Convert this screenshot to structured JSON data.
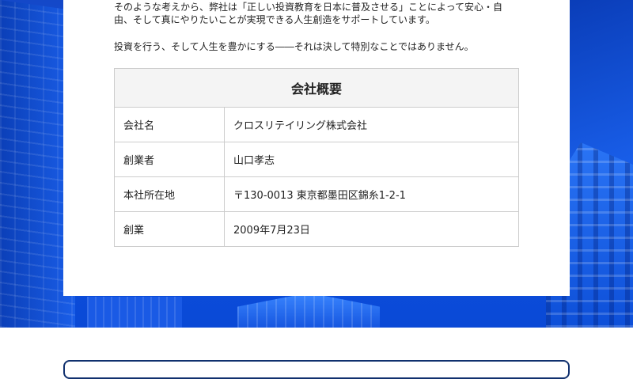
{
  "intro": {
    "line1": "そのような考えから、弊社は「正しい投資教育を日本に普及させる」ことによって安心・自",
    "line2": "由、そして真にやりたいことが実現できる人生創造をサポートしています。",
    "line3": "投資を行う、そして人生を豊かにする――それは決して特別なことではありません。"
  },
  "company_table": {
    "title": "会社概要",
    "rows": [
      {
        "label": "会社名",
        "value": "クロスリテイリング株式会社"
      },
      {
        "label": "創業者",
        "value": "山口孝志"
      },
      {
        "label": "本社所在地",
        "value": "〒130-0013 東京都墨田区錦糸1-2-1"
      },
      {
        "label": "創業",
        "value": "2009年7月23日"
      }
    ]
  },
  "colors": {
    "hero_blue": "#0f56e6",
    "table_header_bg": "#f4f4f4",
    "border": "#cccccc",
    "bottom_box_border": "#10306e"
  }
}
